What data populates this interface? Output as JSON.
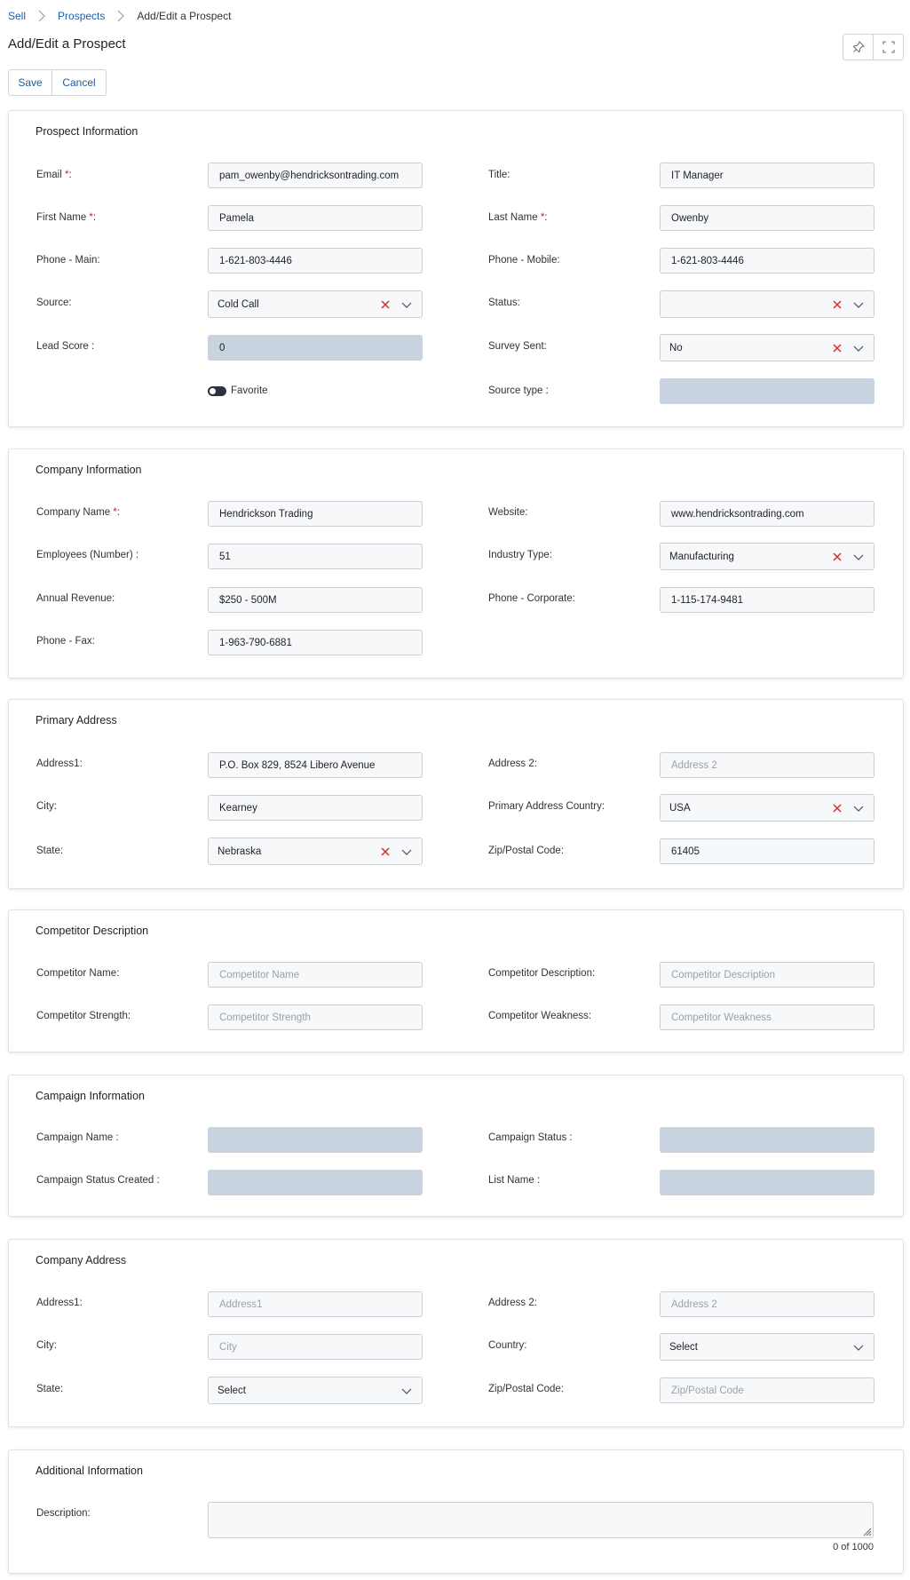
{
  "breadcrumb": {
    "items": [
      {
        "label": "Sell"
      },
      {
        "label": "Prospects"
      },
      {
        "label": "Add/Edit a Prospect"
      }
    ]
  },
  "page": {
    "title": "Add/Edit a Prospect"
  },
  "toolbar": {
    "pin_icon": "pin-icon",
    "expand_icon": "expand-icon"
  },
  "actions": {
    "save_label": "Save",
    "cancel_label": "Cancel"
  },
  "colors": {
    "link": "#1b5fa8",
    "required": "#d11f1f",
    "clear_icon": "#d32f2f",
    "disabled_field": "#c9d3df"
  },
  "prospect": {
    "title": "Prospect Information",
    "email_label": "Email ",
    "email_value": "pam_owenby@hendricksontrading.com",
    "title_label": "Title:",
    "title_value": "IT Manager",
    "first_name_label": "First Name ",
    "first_name_value": "Pamela",
    "last_name_label": "Last Name ",
    "last_name_value": "Owenby",
    "phone_main_label": "Phone - Main:",
    "phone_main_value": "1-621-803-4446",
    "phone_mobile_label": "Phone - Mobile:",
    "phone_mobile_value": "1-621-803-4446",
    "source_label": "Source:",
    "source_value": "Cold Call",
    "status_label": "Status:",
    "status_value": "",
    "lead_score_label": "Lead Score :",
    "lead_score_value": "0",
    "survey_sent_label": "Survey Sent:",
    "survey_sent_value": "No",
    "favorite_label": "Favorite",
    "source_type_label": "Source type :"
  },
  "company": {
    "title": "Company Information",
    "company_name_label": "Company Name ",
    "company_name_value": "Hendrickson Trading",
    "website_label": "Website:",
    "website_value": "www.hendricksontrading.com",
    "employees_label": "Employees (Number) :",
    "employees_value": "51",
    "industry_label": "Industry Type:",
    "industry_value": "Manufacturing",
    "revenue_label": "Annual Revenue:",
    "revenue_value": "$250 - 500M",
    "phone_corporate_label": "Phone - Corporate:",
    "phone_corporate_value": "1-115-174-9481",
    "phone_fax_label": "Phone - Fax:",
    "phone_fax_value": "1-963-790-6881"
  },
  "primary_address": {
    "title": "Primary Address",
    "address1_label": "Address1:",
    "address1_value": "P.O. Box 829, 8524 Libero Avenue",
    "address2_label": "Address 2:",
    "address2_placeholder": "Address 2",
    "city_label": "City:",
    "city_value": "Kearney",
    "country_label": "Primary Address Country:",
    "country_value": "USA",
    "state_label": "State:",
    "state_value": "Nebraska",
    "zip_label": "Zip/Postal Code:",
    "zip_value": "61405"
  },
  "competitor": {
    "title": "Competitor Description",
    "name_label": "Competitor Name:",
    "name_placeholder": "Competitor Name",
    "description_label": "Competitor Description:",
    "description_placeholder": "Competitor Description",
    "strength_label": "Competitor Strength:",
    "strength_placeholder": "Competitor Strength",
    "weakness_label": "Competitor Weakness:",
    "weakness_placeholder": "Competitor Weakness"
  },
  "campaign": {
    "title": "Campaign Information",
    "name_label": "Campaign Name :",
    "status_label": "Campaign Status :",
    "status_created_label": "Campaign Status Created :",
    "list_name_label": "List Name :"
  },
  "company_address": {
    "title": "Company Address",
    "address1_label": "Address1:",
    "address1_placeholder": "Address1",
    "address2_label": "Address 2:",
    "address2_placeholder": "Address 2",
    "city_label": "City:",
    "city_placeholder": "City",
    "country_label": "Country:",
    "country_value": "Select",
    "state_label": "State:",
    "state_value": "Select",
    "zip_label": "Zip/Postal Code:",
    "zip_placeholder": "Zip/Postal Code"
  },
  "additional": {
    "title": "Additional Information",
    "description_label": "Description:",
    "counter": "0 of 1000"
  },
  "required_marker": "*",
  "label_colon": ":"
}
